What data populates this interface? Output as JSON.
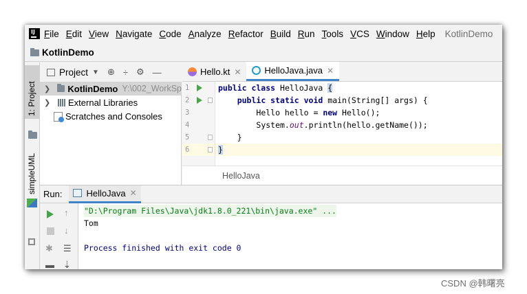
{
  "menubar": {
    "logo_text": "IJ",
    "items": [
      "File",
      "Edit",
      "View",
      "Navigate",
      "Code",
      "Analyze",
      "Refactor",
      "Build",
      "Run",
      "Tools",
      "VCS",
      "Window",
      "Help"
    ],
    "project_title": "KotlinDemo"
  },
  "navbar": {
    "project_name": "KotlinDemo"
  },
  "left_stripe": {
    "project_tab": "1: Project",
    "uml_tab": "simpleUML"
  },
  "project_panel": {
    "view_label": "Project",
    "tree": {
      "root_name": "KotlinDemo",
      "root_path": "Y:\\002_WorkSp",
      "external_libraries": "External Libraries",
      "scratches": "Scratches and Consoles"
    }
  },
  "editor": {
    "tabs": [
      {
        "label": "Hello.kt",
        "active": false
      },
      {
        "label": "HelloJava.java",
        "active": true
      }
    ],
    "line_numbers": [
      "1",
      "2",
      "3",
      "4",
      "5",
      "6"
    ],
    "breadcrumb": "HelloJava"
  },
  "code": {
    "l1_kw": "public class ",
    "l1_name": "HelloJava ",
    "l1_brace": "{",
    "l2_indent": "    ",
    "l2_kw": "public static void ",
    "l2_rest": "main(String[] args) {",
    "l3_indent": "        ",
    "l3_a": "Hello hello = ",
    "l3_kw": "new ",
    "l3_b": "Hello();",
    "l4_indent": "        ",
    "l4_a": "System.",
    "l4_fld": "out",
    "l4_b": ".println(hello.getName());",
    "l5": "    }",
    "l6": "}"
  },
  "run_panel": {
    "label": "Run:",
    "tab_label": "HelloJava",
    "console": {
      "command": "\"D:\\Program Files\\Java\\jdk1.8.0_221\\bin\\java.exe\" ...",
      "output": "Tom",
      "exit": "Process finished with exit code 0"
    }
  },
  "watermark": "CSDN @韩曙亮",
  "colors": {
    "accent": "#4083c9",
    "run_green": "#4aa44a",
    "keyword": "#000080",
    "field": "#660e7a",
    "console_cmd": "#067d17"
  }
}
